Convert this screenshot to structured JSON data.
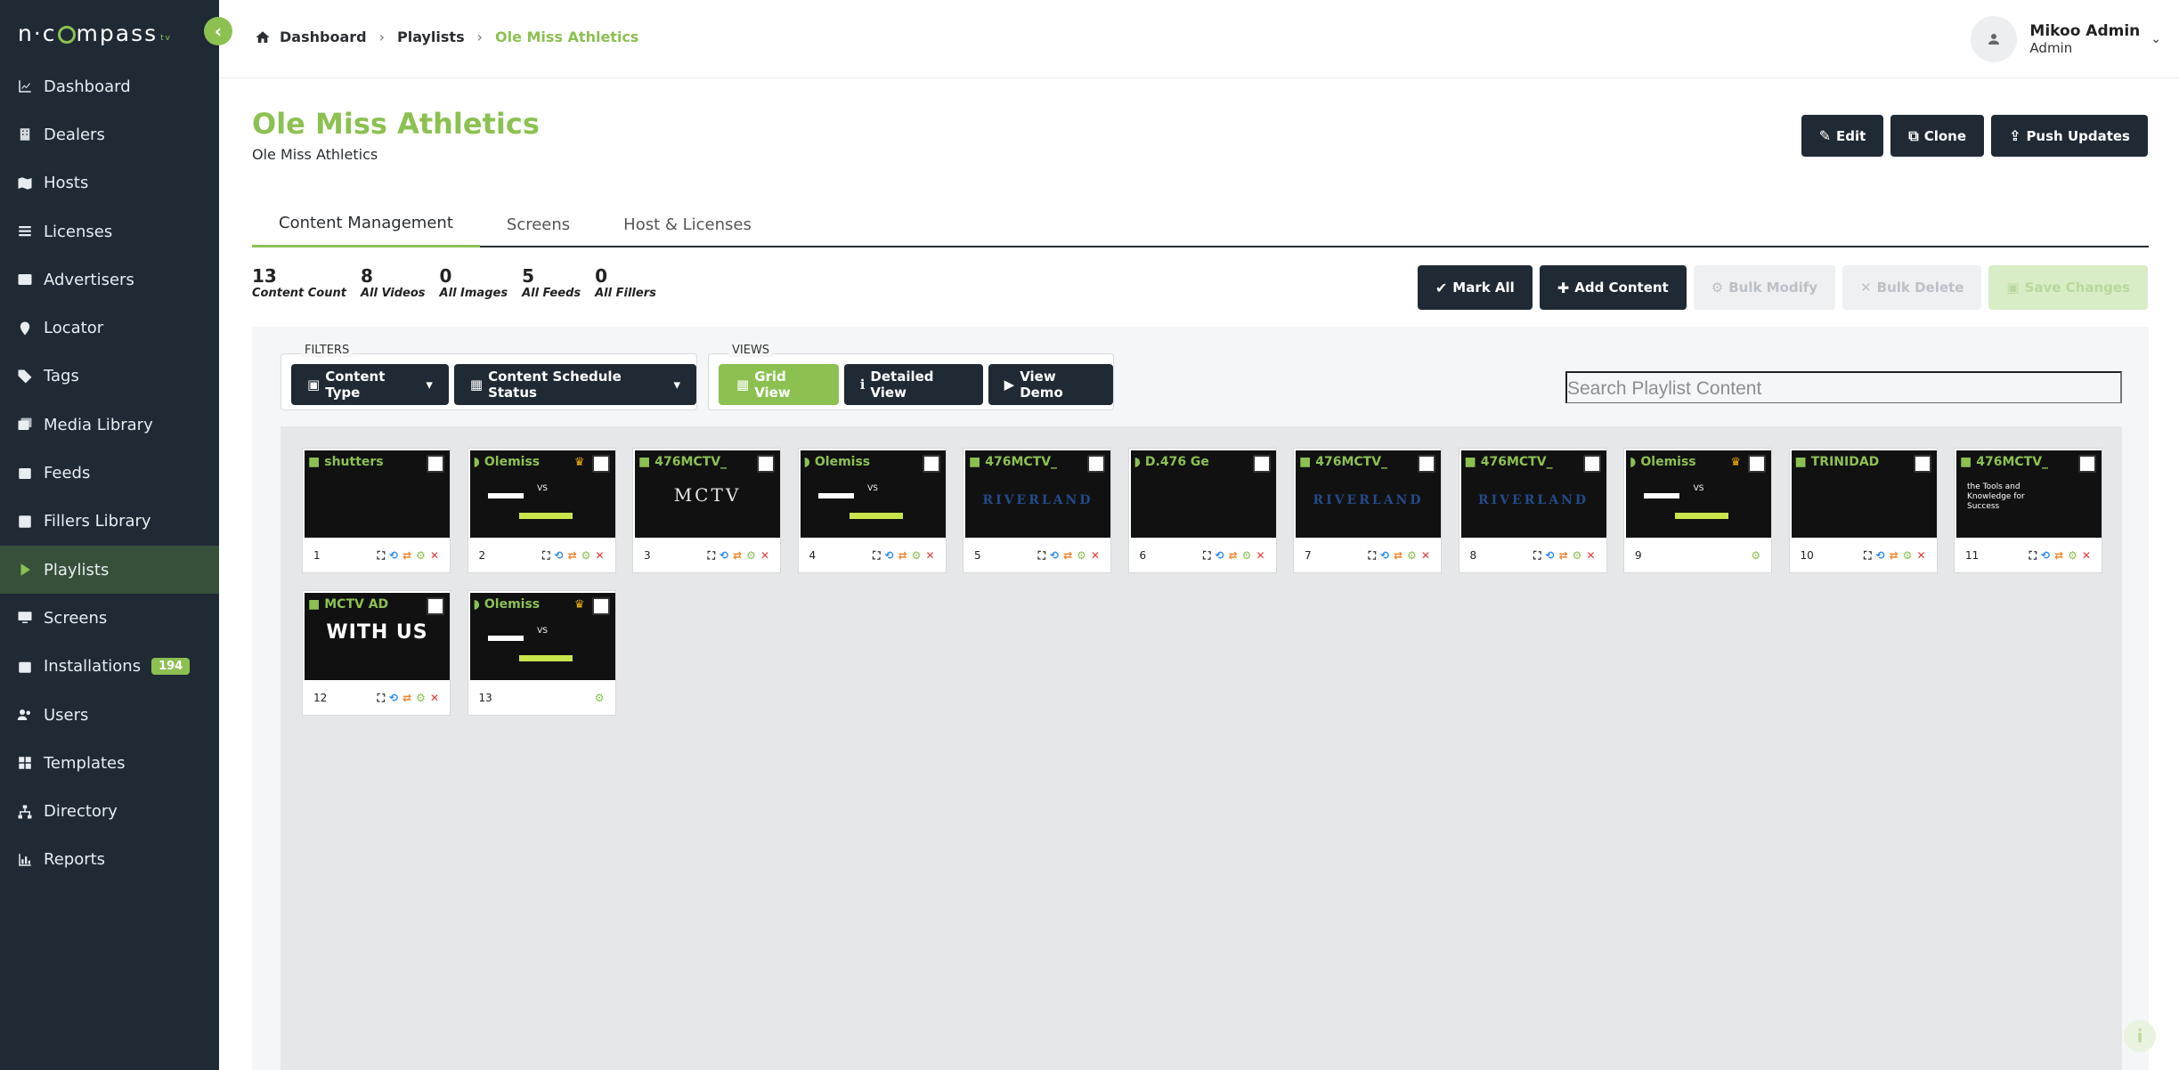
{
  "app": {
    "logo_text": "n·compass",
    "logo_tm": "tv"
  },
  "sidebar": {
    "items": [
      {
        "label": "Dashboard",
        "icon": "chart-line-icon"
      },
      {
        "label": "Dealers",
        "icon": "building-icon"
      },
      {
        "label": "Hosts",
        "icon": "map-icon"
      },
      {
        "label": "Licenses",
        "icon": "list-icon"
      },
      {
        "label": "Advertisers",
        "icon": "ad-icon"
      },
      {
        "label": "Locator",
        "icon": "map-pin-icon"
      },
      {
        "label": "Tags",
        "icon": "tags-icon"
      },
      {
        "label": "Media Library",
        "icon": "images-icon"
      },
      {
        "label": "Feeds",
        "icon": "feed-icon"
      },
      {
        "label": "Fillers Library",
        "icon": "list-alt-icon"
      },
      {
        "label": "Playlists",
        "icon": "play-icon",
        "active": true
      },
      {
        "label": "Screens",
        "icon": "desktop-icon"
      },
      {
        "label": "Installations",
        "icon": "calendar-icon",
        "badge": "194"
      },
      {
        "label": "Users",
        "icon": "users-icon"
      },
      {
        "label": "Templates",
        "icon": "grid-icon"
      },
      {
        "label": "Directory",
        "icon": "sitemap-icon"
      },
      {
        "label": "Reports",
        "icon": "chart-bar-icon"
      }
    ]
  },
  "breadcrumb": {
    "home": "Dashboard",
    "section": "Playlists",
    "current": "Ole Miss Athletics"
  },
  "user": {
    "name": "Mikoo Admin",
    "role": "Admin"
  },
  "page": {
    "title": "Ole Miss Athletics",
    "subtitle": "Ole Miss Athletics"
  },
  "header_buttons": {
    "edit": "Edit",
    "clone": "Clone",
    "push": "Push Updates"
  },
  "tabs": {
    "content": "Content Management",
    "screens": "Screens",
    "hosts": "Host & Licenses"
  },
  "stats": [
    {
      "value": "13",
      "label": "Content Count"
    },
    {
      "value": "8",
      "label": "All Videos"
    },
    {
      "value": "0",
      "label": "All Images"
    },
    {
      "value": "5",
      "label": "All Feeds"
    },
    {
      "value": "0",
      "label": "All Fillers"
    }
  ],
  "actions": {
    "mark_all": "Mark All",
    "add_content": "Add Content",
    "bulk_modify": "Bulk Modify",
    "bulk_delete": "Bulk Delete",
    "save_changes": "Save Changes"
  },
  "filters": {
    "group_label": "FILTERS",
    "content_type": "Content Type",
    "schedule_status": "Content Schedule Status"
  },
  "views": {
    "group_label": "VIEWS",
    "grid": "Grid View",
    "detailed": "Detailed View",
    "demo": "View Demo"
  },
  "search": {
    "placeholder": "Search Playlist Content"
  },
  "cards": [
    {
      "num": "1",
      "title": "shutters",
      "kind": "video",
      "thumb": "photo"
    },
    {
      "num": "2",
      "title": "Olemiss",
      "kind": "feed",
      "thumb": "red",
      "crown": true
    },
    {
      "num": "3",
      "title": "476MCTV_",
      "kind": "video",
      "thumb": "mctv",
      "mark": "MCTV"
    },
    {
      "num": "4",
      "title": "Olemiss",
      "kind": "feed",
      "thumb": "red"
    },
    {
      "num": "5",
      "title": "476MCTV_",
      "kind": "video",
      "thumb": "river",
      "mark": "RIVERLAND"
    },
    {
      "num": "6",
      "title": "D.476 Ge",
      "kind": "feed",
      "thumb": "black"
    },
    {
      "num": "7",
      "title": "476MCTV_",
      "kind": "video",
      "thumb": "river",
      "mark": "RIVERLAND"
    },
    {
      "num": "8",
      "title": "476MCTV_",
      "kind": "video",
      "thumb": "river",
      "mark": "RIVERLAND"
    },
    {
      "num": "9",
      "title": "Olemiss",
      "kind": "feed",
      "thumb": "red",
      "crown": true,
      "settings_only": true
    },
    {
      "num": "10",
      "title": "TRINIDAD",
      "kind": "video",
      "thumb": "flag"
    },
    {
      "num": "11",
      "title": "476MCTV_",
      "kind": "video",
      "thumb": "tools",
      "mark": "the Tools and Knowledge for Success"
    },
    {
      "num": "12",
      "title": "MCTV AD",
      "kind": "video",
      "thumb": "withus",
      "mark": "WITH US"
    },
    {
      "num": "13",
      "title": "Olemiss",
      "kind": "feed",
      "thumb": "red",
      "crown": true,
      "settings_only": true
    }
  ],
  "card_action_glyphs": {
    "expand": "⛶",
    "repeat": "⟲",
    "swap": "⇄",
    "settings": "⚙",
    "delete": "✕"
  },
  "colors": {
    "accent": "#8cc152",
    "sidebar_bg": "#1f2a35",
    "dark_button": "#1f2a35",
    "delete": "#e53935"
  }
}
